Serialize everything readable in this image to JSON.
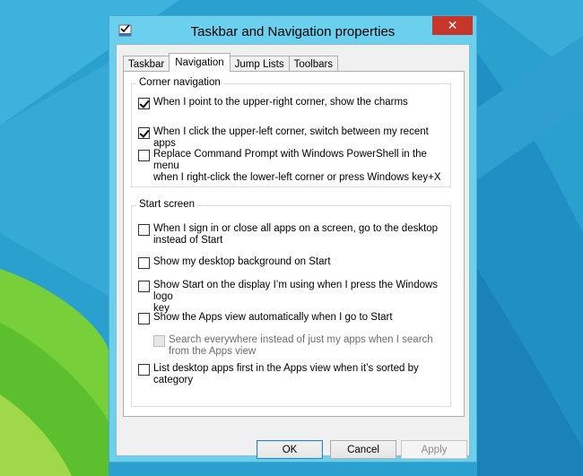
{
  "window": {
    "title": "Taskbar and Navigation properties",
    "close_glyph": "✕",
    "icon": "taskbar-properties-icon"
  },
  "tabs": [
    {
      "label": "Taskbar",
      "active": false
    },
    {
      "label": "Navigation",
      "active": true
    },
    {
      "label": "Jump Lists",
      "active": false
    },
    {
      "label": "Toolbars",
      "active": false
    }
  ],
  "corner_navigation": {
    "label": "Corner navigation",
    "options": [
      {
        "text": "When I point to the upper-right corner, show the charms",
        "checked": true,
        "enabled": true
      },
      {
        "text": "When I click the upper-left corner, switch between my recent apps",
        "checked": true,
        "enabled": true
      },
      {
        "text": "Replace Command Prompt with Windows PowerShell in the menu\nwhen I right-click the lower-left corner or press Windows key+X",
        "checked": false,
        "enabled": true
      }
    ]
  },
  "start_screen": {
    "label": "Start screen",
    "options": [
      {
        "text": "When I sign in or close all apps on a screen, go to the desktop\ninstead of Start",
        "checked": false,
        "enabled": true
      },
      {
        "text": "Show my desktop background on Start",
        "checked": false,
        "enabled": true
      },
      {
        "text": "Show Start on the display I’m using when I press the Windows logo\nkey",
        "checked": false,
        "enabled": true
      },
      {
        "text": "Show the Apps view automatically when I go to Start",
        "checked": false,
        "enabled": true
      },
      {
        "text": "Search everywhere instead of just my apps when I search\nfrom the Apps view",
        "checked": false,
        "enabled": false
      },
      {
        "text": "List desktop apps first in the Apps view when it’s sorted by\ncategory",
        "checked": false,
        "enabled": true
      }
    ]
  },
  "buttons": {
    "ok": "OK",
    "cancel": "Cancel",
    "apply": "Apply"
  },
  "colors": {
    "desktop": "#2fa3cf",
    "window_frame": "#6ad0ee",
    "close_button": "#c7362b"
  }
}
